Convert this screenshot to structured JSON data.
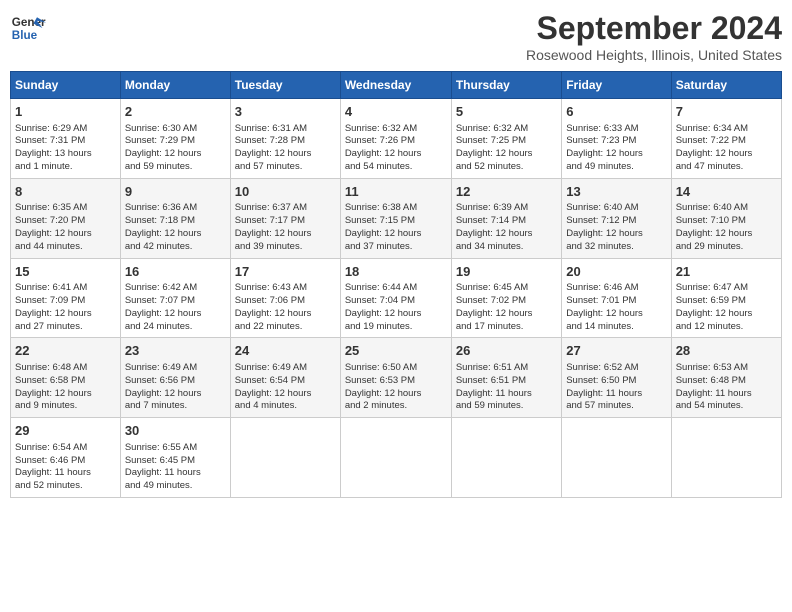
{
  "header": {
    "logo_line1": "General",
    "logo_line2": "Blue",
    "month_year": "September 2024",
    "location": "Rosewood Heights, Illinois, United States"
  },
  "days_of_week": [
    "Sunday",
    "Monday",
    "Tuesday",
    "Wednesday",
    "Thursday",
    "Friday",
    "Saturday"
  ],
  "weeks": [
    [
      {
        "day": 1,
        "lines": [
          "Sunrise: 6:29 AM",
          "Sunset: 7:31 PM",
          "Daylight: 13 hours",
          "and 1 minute."
        ]
      },
      {
        "day": 2,
        "lines": [
          "Sunrise: 6:30 AM",
          "Sunset: 7:29 PM",
          "Daylight: 12 hours",
          "and 59 minutes."
        ]
      },
      {
        "day": 3,
        "lines": [
          "Sunrise: 6:31 AM",
          "Sunset: 7:28 PM",
          "Daylight: 12 hours",
          "and 57 minutes."
        ]
      },
      {
        "day": 4,
        "lines": [
          "Sunrise: 6:32 AM",
          "Sunset: 7:26 PM",
          "Daylight: 12 hours",
          "and 54 minutes."
        ]
      },
      {
        "day": 5,
        "lines": [
          "Sunrise: 6:32 AM",
          "Sunset: 7:25 PM",
          "Daylight: 12 hours",
          "and 52 minutes."
        ]
      },
      {
        "day": 6,
        "lines": [
          "Sunrise: 6:33 AM",
          "Sunset: 7:23 PM",
          "Daylight: 12 hours",
          "and 49 minutes."
        ]
      },
      {
        "day": 7,
        "lines": [
          "Sunrise: 6:34 AM",
          "Sunset: 7:22 PM",
          "Daylight: 12 hours",
          "and 47 minutes."
        ]
      }
    ],
    [
      {
        "day": 8,
        "lines": [
          "Sunrise: 6:35 AM",
          "Sunset: 7:20 PM",
          "Daylight: 12 hours",
          "and 44 minutes."
        ]
      },
      {
        "day": 9,
        "lines": [
          "Sunrise: 6:36 AM",
          "Sunset: 7:18 PM",
          "Daylight: 12 hours",
          "and 42 minutes."
        ]
      },
      {
        "day": 10,
        "lines": [
          "Sunrise: 6:37 AM",
          "Sunset: 7:17 PM",
          "Daylight: 12 hours",
          "and 39 minutes."
        ]
      },
      {
        "day": 11,
        "lines": [
          "Sunrise: 6:38 AM",
          "Sunset: 7:15 PM",
          "Daylight: 12 hours",
          "and 37 minutes."
        ]
      },
      {
        "day": 12,
        "lines": [
          "Sunrise: 6:39 AM",
          "Sunset: 7:14 PM",
          "Daylight: 12 hours",
          "and 34 minutes."
        ]
      },
      {
        "day": 13,
        "lines": [
          "Sunrise: 6:40 AM",
          "Sunset: 7:12 PM",
          "Daylight: 12 hours",
          "and 32 minutes."
        ]
      },
      {
        "day": 14,
        "lines": [
          "Sunrise: 6:40 AM",
          "Sunset: 7:10 PM",
          "Daylight: 12 hours",
          "and 29 minutes."
        ]
      }
    ],
    [
      {
        "day": 15,
        "lines": [
          "Sunrise: 6:41 AM",
          "Sunset: 7:09 PM",
          "Daylight: 12 hours",
          "and 27 minutes."
        ]
      },
      {
        "day": 16,
        "lines": [
          "Sunrise: 6:42 AM",
          "Sunset: 7:07 PM",
          "Daylight: 12 hours",
          "and 24 minutes."
        ]
      },
      {
        "day": 17,
        "lines": [
          "Sunrise: 6:43 AM",
          "Sunset: 7:06 PM",
          "Daylight: 12 hours",
          "and 22 minutes."
        ]
      },
      {
        "day": 18,
        "lines": [
          "Sunrise: 6:44 AM",
          "Sunset: 7:04 PM",
          "Daylight: 12 hours",
          "and 19 minutes."
        ]
      },
      {
        "day": 19,
        "lines": [
          "Sunrise: 6:45 AM",
          "Sunset: 7:02 PM",
          "Daylight: 12 hours",
          "and 17 minutes."
        ]
      },
      {
        "day": 20,
        "lines": [
          "Sunrise: 6:46 AM",
          "Sunset: 7:01 PM",
          "Daylight: 12 hours",
          "and 14 minutes."
        ]
      },
      {
        "day": 21,
        "lines": [
          "Sunrise: 6:47 AM",
          "Sunset: 6:59 PM",
          "Daylight: 12 hours",
          "and 12 minutes."
        ]
      }
    ],
    [
      {
        "day": 22,
        "lines": [
          "Sunrise: 6:48 AM",
          "Sunset: 6:58 PM",
          "Daylight: 12 hours",
          "and 9 minutes."
        ]
      },
      {
        "day": 23,
        "lines": [
          "Sunrise: 6:49 AM",
          "Sunset: 6:56 PM",
          "Daylight: 12 hours",
          "and 7 minutes."
        ]
      },
      {
        "day": 24,
        "lines": [
          "Sunrise: 6:49 AM",
          "Sunset: 6:54 PM",
          "Daylight: 12 hours",
          "and 4 minutes."
        ]
      },
      {
        "day": 25,
        "lines": [
          "Sunrise: 6:50 AM",
          "Sunset: 6:53 PM",
          "Daylight: 12 hours",
          "and 2 minutes."
        ]
      },
      {
        "day": 26,
        "lines": [
          "Sunrise: 6:51 AM",
          "Sunset: 6:51 PM",
          "Daylight: 11 hours",
          "and 59 minutes."
        ]
      },
      {
        "day": 27,
        "lines": [
          "Sunrise: 6:52 AM",
          "Sunset: 6:50 PM",
          "Daylight: 11 hours",
          "and 57 minutes."
        ]
      },
      {
        "day": 28,
        "lines": [
          "Sunrise: 6:53 AM",
          "Sunset: 6:48 PM",
          "Daylight: 11 hours",
          "and 54 minutes."
        ]
      }
    ],
    [
      {
        "day": 29,
        "lines": [
          "Sunrise: 6:54 AM",
          "Sunset: 6:46 PM",
          "Daylight: 11 hours",
          "and 52 minutes."
        ]
      },
      {
        "day": 30,
        "lines": [
          "Sunrise: 6:55 AM",
          "Sunset: 6:45 PM",
          "Daylight: 11 hours",
          "and 49 minutes."
        ]
      },
      null,
      null,
      null,
      null,
      null
    ]
  ]
}
